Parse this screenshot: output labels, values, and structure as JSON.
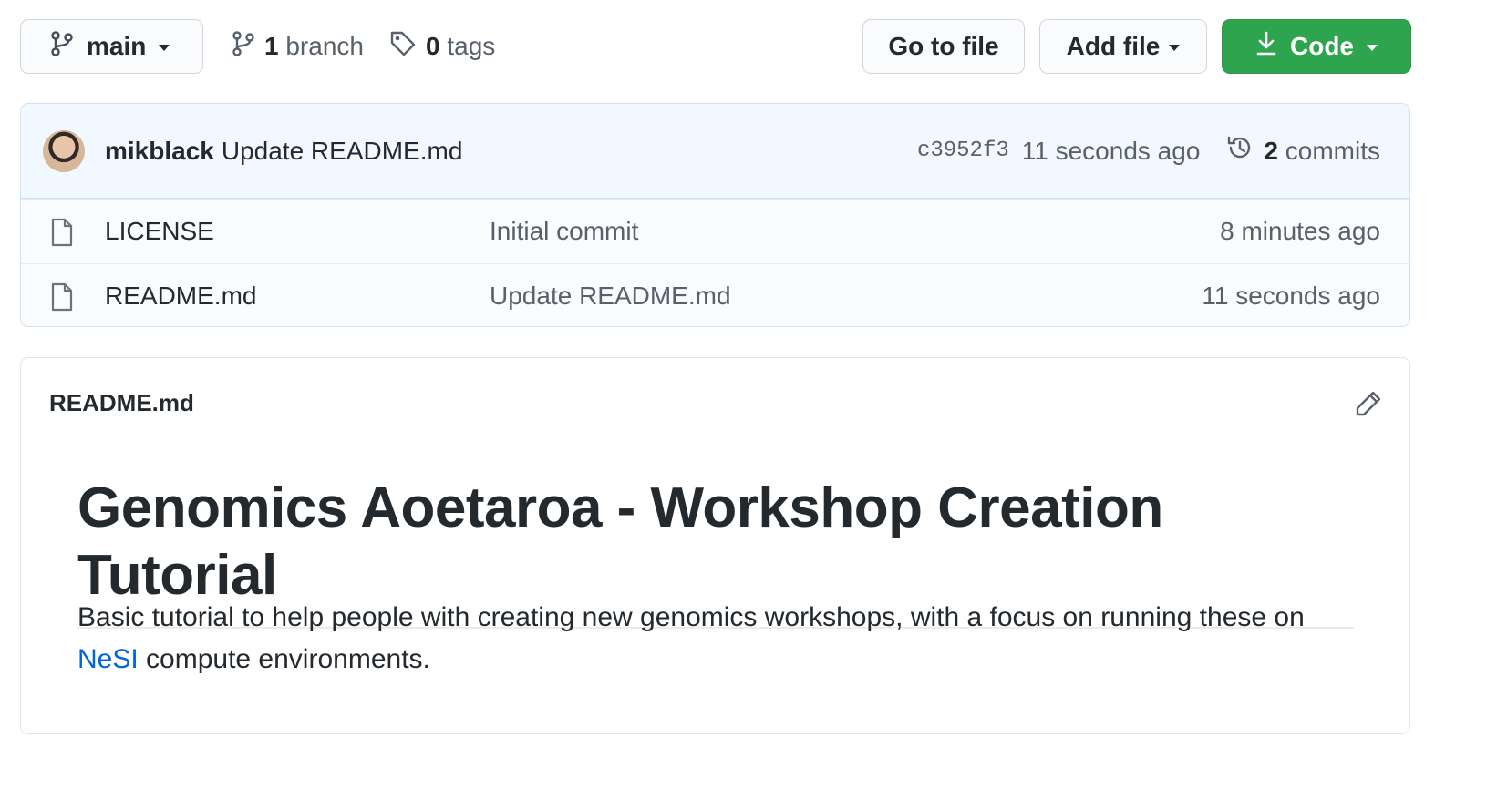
{
  "toolbar": {
    "branch_name": "main",
    "branch_count": "1",
    "branch_label": "branch",
    "tag_count": "0",
    "tag_label": "tags",
    "go_to_file": "Go to file",
    "add_file": "Add file",
    "code": "Code"
  },
  "latest_commit": {
    "author": "mikblack",
    "message": "Update README.md",
    "sha": "c3952f3",
    "time": "11 seconds ago",
    "commit_count": "2",
    "commit_label": "commits"
  },
  "files": [
    {
      "name": "LICENSE",
      "commit": "Initial commit",
      "age": "8 minutes ago"
    },
    {
      "name": "README.md",
      "commit": "Update README.md",
      "age": "11 seconds ago"
    }
  ],
  "readme": {
    "filename": "README.md",
    "heading": "Genomics Aoetaroa - Workshop Creation Tutorial",
    "para_before_link": "Basic tutorial to help people with creating new genomics workshops, with a focus on running these on ",
    "link_text": "NeSI",
    "para_after_link": " compute environments."
  },
  "colors": {
    "code_button": "#2ea44f",
    "commit_bar": "#f1f8ff",
    "link": "#0366d6"
  }
}
